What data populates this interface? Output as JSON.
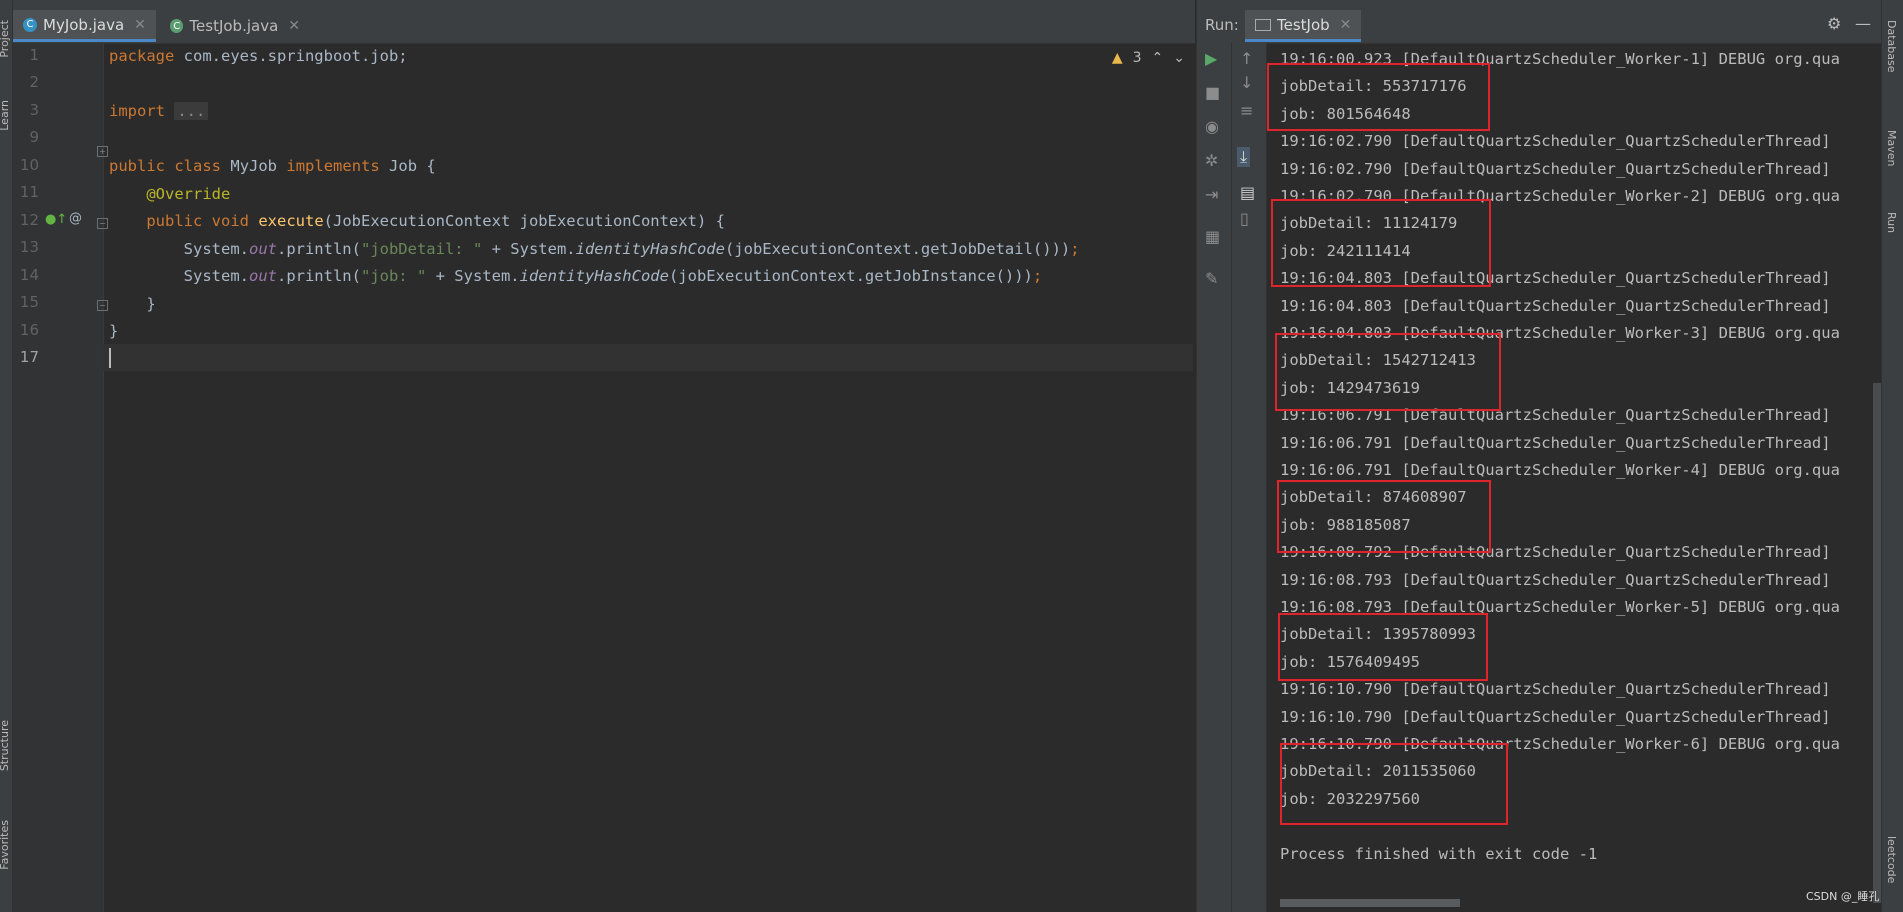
{
  "left_strip": {
    "project": "Project",
    "learn": "Learn",
    "structure": "Structure",
    "favorites": "Favorites"
  },
  "editor": {
    "tabs": [
      {
        "label": "MyJob.java",
        "active": true
      },
      {
        "label": "TestJob.java",
        "active": false
      }
    ],
    "warnings_count": "3",
    "line_numbers": [
      "1",
      "2",
      "3",
      "10",
      "11",
      "12",
      "13",
      "14",
      "15",
      "16",
      "17"
    ],
    "code": {
      "l1_kw": "package",
      "l1_rest": " com.eyes.springboot.job;",
      "l3_kw": "import",
      "l3_fold": "...",
      "l10_kw1": "public",
      "l10_kw2": "class",
      "l10_name": "MyJob",
      "l10_kw3": "implements",
      "l10_rest": "Job {",
      "l11_ann": "@Override",
      "l12_kw1": "public",
      "l12_kw2": "void",
      "l12_fn": "execute",
      "l12_rest": "(JobExecutionContext jobExecutionContext) {",
      "l13_a": "System.",
      "l13_out": "out",
      "l13_b": ".println(",
      "l13_str": "\"jobDetail: \"",
      "l13_c": " + System.",
      "l13_it": "identityHashCode",
      "l13_d": "(jobExecutionContext.getJobDetail()))",
      "l13_semi": ";",
      "l14_a": "System.",
      "l14_out": "out",
      "l14_b": ".println(",
      "l14_str": "\"job: \"",
      "l14_c": " + System.",
      "l14_it": "identityHashCode",
      "l14_d": "(jobExecutionContext.getJobInstance()))",
      "l14_semi": ";",
      "l15": "}",
      "l16": "}"
    }
  },
  "run": {
    "label": "Run:",
    "tab": "TestJob",
    "console": [
      "19:16:00.923 [DefaultQuartzScheduler_Worker-1] DEBUG org.qua",
      "jobDetail: 553717176",
      "job: 801564648",
      "19:16:02.790 [DefaultQuartzScheduler_QuartzSchedulerThread] ",
      "19:16:02.790 [DefaultQuartzScheduler_QuartzSchedulerThread] ",
      "19:16:02.790 [DefaultQuartzScheduler_Worker-2] DEBUG org.qua",
      "jobDetail: 11124179",
      "job: 242111414",
      "19:16:04.803 [DefaultQuartzScheduler_QuartzSchedulerThread] ",
      "19:16:04.803 [DefaultQuartzScheduler_QuartzSchedulerThread] ",
      "19:16:04.803 [DefaultQuartzScheduler_Worker-3] DEBUG org.qua",
      "jobDetail: 1542712413",
      "job: 1429473619",
      "19:16:06.791 [DefaultQuartzScheduler_QuartzSchedulerThread] ",
      "19:16:06.791 [DefaultQuartzScheduler_QuartzSchedulerThread] ",
      "19:16:06.791 [DefaultQuartzScheduler_Worker-4] DEBUG org.qua",
      "jobDetail: 874608907",
      "job: 988185087",
      "19:16:08.792 [DefaultQuartzScheduler_QuartzSchedulerThread] ",
      "19:16:08.793 [DefaultQuartzScheduler_QuartzSchedulerThread] ",
      "19:16:08.793 [DefaultQuartzScheduler_Worker-5] DEBUG org.qua",
      "jobDetail: 1395780993",
      "job: 1576409495",
      "19:16:10.790 [DefaultQuartzScheduler_QuartzSchedulerThread] ",
      "19:16:10.790 [DefaultQuartzScheduler_QuartzSchedulerThread] ",
      "19:16:10.790 [DefaultQuartzScheduler_Worker-6] DEBUG org.qua",
      "jobDetail: 2011535060",
      "job: 2032297560",
      "",
      "Process finished with exit code -1"
    ]
  },
  "right_strip": {
    "database": "Database",
    "maven": "Maven",
    "run": "Run",
    "leetcode": "leetcode"
  },
  "watermark": "CSDN @_睡孔",
  "colors": {
    "highlight_box": "#e0242c",
    "accent": "#4a88c7"
  }
}
